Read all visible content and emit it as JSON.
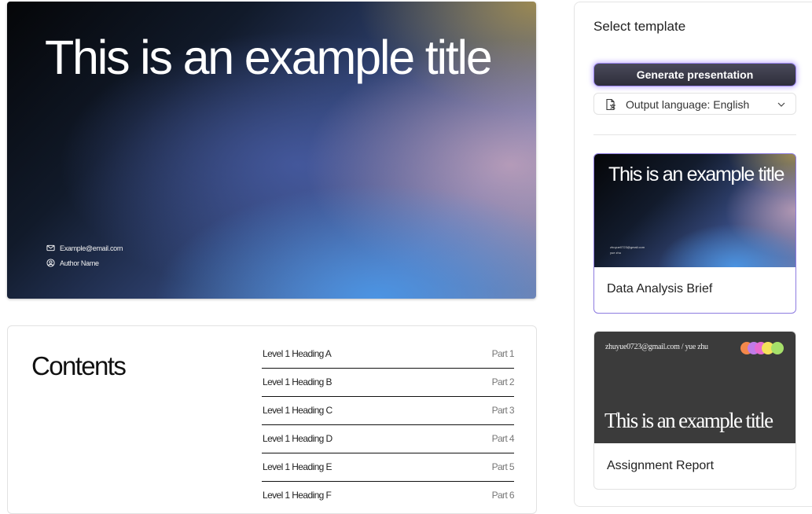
{
  "slide": {
    "title": "This is an example title",
    "email": "Example@email.com",
    "author": "Author Name"
  },
  "contents": {
    "heading": "Contents",
    "items": [
      {
        "label": "Level 1 Heading A",
        "part": "Part 1"
      },
      {
        "label": "Level 1 Heading B",
        "part": "Part 2"
      },
      {
        "label": "Level 1 Heading C",
        "part": "Part 3"
      },
      {
        "label": "Level 1 Heading D",
        "part": "Part 4"
      },
      {
        "label": "Level 1 Heading E",
        "part": "Part 5"
      },
      {
        "label": "Level 1 Heading F",
        "part": "Part 6"
      }
    ]
  },
  "panel": {
    "title": "Select template",
    "generate_label": "Generate presentation",
    "language_label": "Output language: English",
    "templates": [
      {
        "name": "Data Analysis Brief",
        "thumb_title": "This is an example title",
        "thumb_email": "zhuyue0723@gmail.com",
        "thumb_author": "yue zhu",
        "selected": true
      },
      {
        "name": "Assignment Report",
        "thumb_title": "This is an example title",
        "thumb_meta": "zhuyue0723@gmail.com / yue zhu",
        "selected": false
      }
    ]
  },
  "colors": {
    "accent": "#8d7be0",
    "button_bg": "#3a3a48",
    "dots": [
      "#f4884a",
      "#c07be8",
      "#e86bd0",
      "#f4e25a",
      "#a6e06a"
    ]
  },
  "icons": {
    "email": "mail-icon",
    "author": "user-circle-icon",
    "language": "document-translate-icon",
    "dropdown": "chevron-down-icon"
  }
}
